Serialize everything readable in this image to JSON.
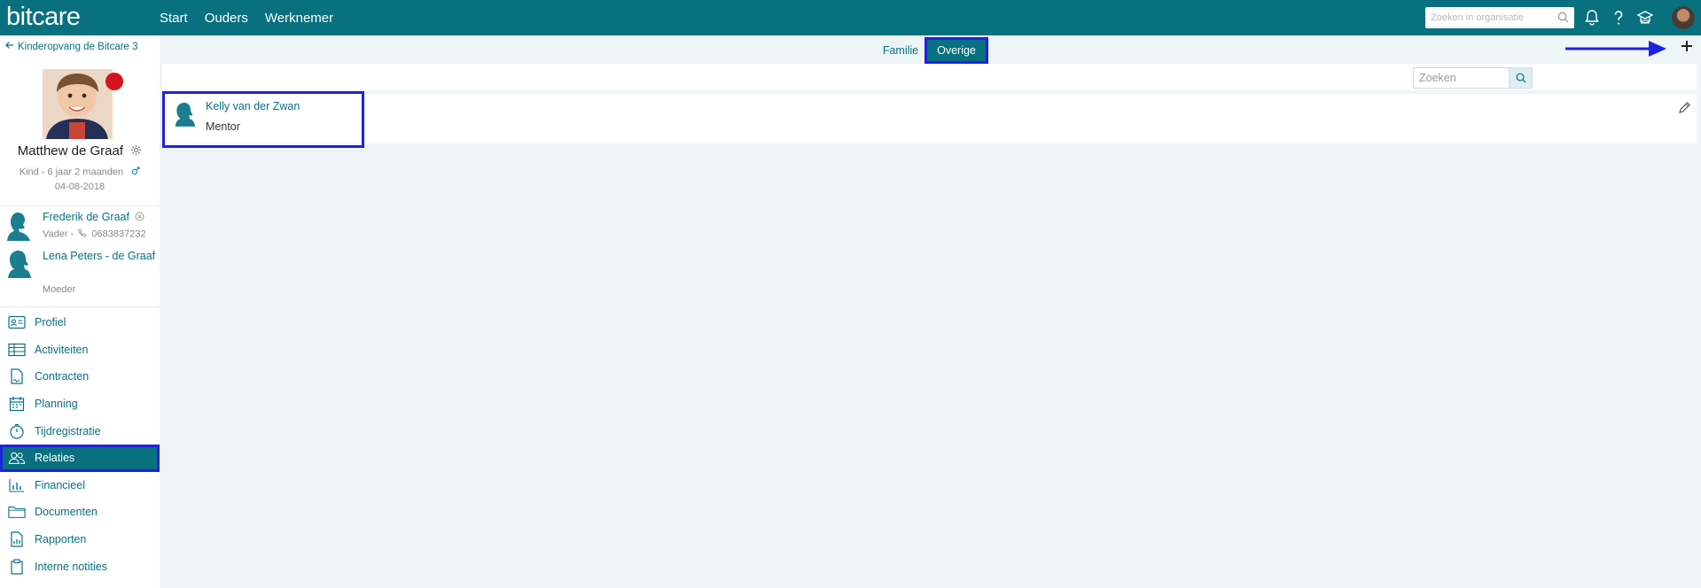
{
  "app": {
    "logo": "bitcare"
  },
  "topnav": {
    "items": [
      "Start",
      "Ouders",
      "Werknemer"
    ]
  },
  "topsearch": {
    "placeholder": "Zoeken in organisatie"
  },
  "sidebar": {
    "back_link": "Kinderopvang de Bitcare 3",
    "child": {
      "name": "Matthew de Graaf",
      "meta": "Kind - 6 jaar 2 maanden",
      "dob": "04-08-2018",
      "status_color": "#d3141e"
    },
    "parents": [
      {
        "name": "Frederik de Graaf",
        "role": "Vader -",
        "phone": "0683837232"
      },
      {
        "name": "Lena Peters - de Graaf",
        "role": "Moeder"
      }
    ],
    "menu": [
      {
        "label": "Profiel",
        "icon": "id-card-icon"
      },
      {
        "label": "Activiteiten",
        "icon": "table-icon"
      },
      {
        "label": "Contracten",
        "icon": "contract-icon"
      },
      {
        "label": "Planning",
        "icon": "calendar-icon"
      },
      {
        "label": "Tijdregistratie",
        "icon": "stopwatch-icon"
      },
      {
        "label": "Relaties",
        "icon": "people-icon",
        "active": true
      },
      {
        "label": "Financieel",
        "icon": "bar-chart-icon"
      },
      {
        "label": "Documenten",
        "icon": "folder-icon"
      },
      {
        "label": "Rapporten",
        "icon": "report-icon"
      },
      {
        "label": "Interne notities",
        "icon": "clipboard-icon"
      }
    ]
  },
  "tabs": {
    "familie": "Familie",
    "overige": "Overige",
    "active": "Overige"
  },
  "search": {
    "placeholder": "Zoeken"
  },
  "relations": [
    {
      "name": "Kelly van der Zwan",
      "role": "Mentor"
    }
  ],
  "colors": {
    "brand": "#08707f",
    "highlight": "#1e22e0",
    "background": "#eef5f7"
  }
}
